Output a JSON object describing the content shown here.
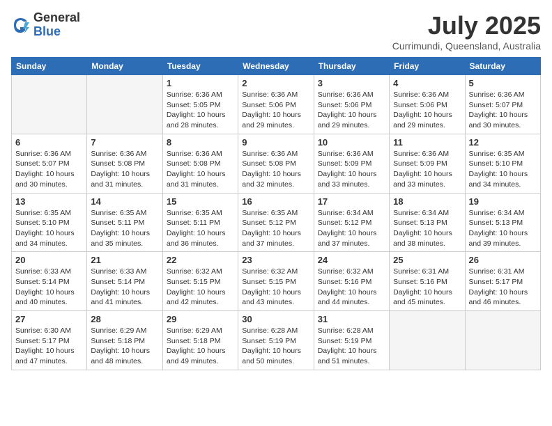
{
  "logo": {
    "general": "General",
    "blue": "Blue"
  },
  "title": {
    "month": "July 2025",
    "location": "Currimundi, Queensland, Australia"
  },
  "headers": [
    "Sunday",
    "Monday",
    "Tuesday",
    "Wednesday",
    "Thursday",
    "Friday",
    "Saturday"
  ],
  "weeks": [
    [
      {
        "day": "",
        "info": ""
      },
      {
        "day": "",
        "info": ""
      },
      {
        "day": "1",
        "info": "Sunrise: 6:36 AM\nSunset: 5:05 PM\nDaylight: 10 hours\nand 28 minutes."
      },
      {
        "day": "2",
        "info": "Sunrise: 6:36 AM\nSunset: 5:06 PM\nDaylight: 10 hours\nand 29 minutes."
      },
      {
        "day": "3",
        "info": "Sunrise: 6:36 AM\nSunset: 5:06 PM\nDaylight: 10 hours\nand 29 minutes."
      },
      {
        "day": "4",
        "info": "Sunrise: 6:36 AM\nSunset: 5:06 PM\nDaylight: 10 hours\nand 29 minutes."
      },
      {
        "day": "5",
        "info": "Sunrise: 6:36 AM\nSunset: 5:07 PM\nDaylight: 10 hours\nand 30 minutes."
      }
    ],
    [
      {
        "day": "6",
        "info": "Sunrise: 6:36 AM\nSunset: 5:07 PM\nDaylight: 10 hours\nand 30 minutes."
      },
      {
        "day": "7",
        "info": "Sunrise: 6:36 AM\nSunset: 5:08 PM\nDaylight: 10 hours\nand 31 minutes."
      },
      {
        "day": "8",
        "info": "Sunrise: 6:36 AM\nSunset: 5:08 PM\nDaylight: 10 hours\nand 31 minutes."
      },
      {
        "day": "9",
        "info": "Sunrise: 6:36 AM\nSunset: 5:08 PM\nDaylight: 10 hours\nand 32 minutes."
      },
      {
        "day": "10",
        "info": "Sunrise: 6:36 AM\nSunset: 5:09 PM\nDaylight: 10 hours\nand 33 minutes."
      },
      {
        "day": "11",
        "info": "Sunrise: 6:36 AM\nSunset: 5:09 PM\nDaylight: 10 hours\nand 33 minutes."
      },
      {
        "day": "12",
        "info": "Sunrise: 6:35 AM\nSunset: 5:10 PM\nDaylight: 10 hours\nand 34 minutes."
      }
    ],
    [
      {
        "day": "13",
        "info": "Sunrise: 6:35 AM\nSunset: 5:10 PM\nDaylight: 10 hours\nand 34 minutes."
      },
      {
        "day": "14",
        "info": "Sunrise: 6:35 AM\nSunset: 5:11 PM\nDaylight: 10 hours\nand 35 minutes."
      },
      {
        "day": "15",
        "info": "Sunrise: 6:35 AM\nSunset: 5:11 PM\nDaylight: 10 hours\nand 36 minutes."
      },
      {
        "day": "16",
        "info": "Sunrise: 6:35 AM\nSunset: 5:12 PM\nDaylight: 10 hours\nand 37 minutes."
      },
      {
        "day": "17",
        "info": "Sunrise: 6:34 AM\nSunset: 5:12 PM\nDaylight: 10 hours\nand 37 minutes."
      },
      {
        "day": "18",
        "info": "Sunrise: 6:34 AM\nSunset: 5:13 PM\nDaylight: 10 hours\nand 38 minutes."
      },
      {
        "day": "19",
        "info": "Sunrise: 6:34 AM\nSunset: 5:13 PM\nDaylight: 10 hours\nand 39 minutes."
      }
    ],
    [
      {
        "day": "20",
        "info": "Sunrise: 6:33 AM\nSunset: 5:14 PM\nDaylight: 10 hours\nand 40 minutes."
      },
      {
        "day": "21",
        "info": "Sunrise: 6:33 AM\nSunset: 5:14 PM\nDaylight: 10 hours\nand 41 minutes."
      },
      {
        "day": "22",
        "info": "Sunrise: 6:32 AM\nSunset: 5:15 PM\nDaylight: 10 hours\nand 42 minutes."
      },
      {
        "day": "23",
        "info": "Sunrise: 6:32 AM\nSunset: 5:15 PM\nDaylight: 10 hours\nand 43 minutes."
      },
      {
        "day": "24",
        "info": "Sunrise: 6:32 AM\nSunset: 5:16 PM\nDaylight: 10 hours\nand 44 minutes."
      },
      {
        "day": "25",
        "info": "Sunrise: 6:31 AM\nSunset: 5:16 PM\nDaylight: 10 hours\nand 45 minutes."
      },
      {
        "day": "26",
        "info": "Sunrise: 6:31 AM\nSunset: 5:17 PM\nDaylight: 10 hours\nand 46 minutes."
      }
    ],
    [
      {
        "day": "27",
        "info": "Sunrise: 6:30 AM\nSunset: 5:17 PM\nDaylight: 10 hours\nand 47 minutes."
      },
      {
        "day": "28",
        "info": "Sunrise: 6:29 AM\nSunset: 5:18 PM\nDaylight: 10 hours\nand 48 minutes."
      },
      {
        "day": "29",
        "info": "Sunrise: 6:29 AM\nSunset: 5:18 PM\nDaylight: 10 hours\nand 49 minutes."
      },
      {
        "day": "30",
        "info": "Sunrise: 6:28 AM\nSunset: 5:19 PM\nDaylight: 10 hours\nand 50 minutes."
      },
      {
        "day": "31",
        "info": "Sunrise: 6:28 AM\nSunset: 5:19 PM\nDaylight: 10 hours\nand 51 minutes."
      },
      {
        "day": "",
        "info": ""
      },
      {
        "day": "",
        "info": ""
      }
    ]
  ]
}
